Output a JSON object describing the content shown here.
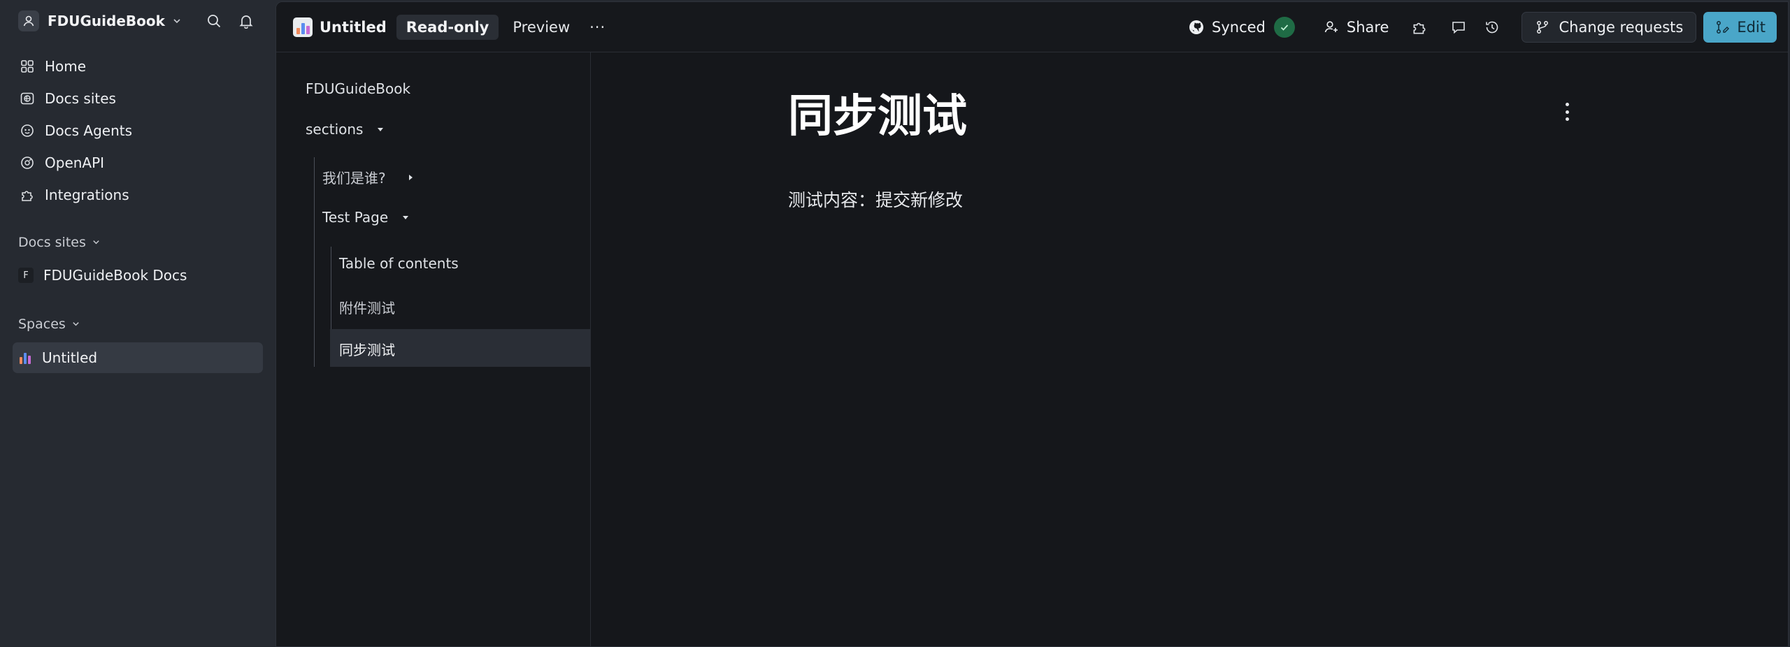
{
  "org": {
    "name": "FDUGuideBook"
  },
  "sidebar": {
    "nav": [
      {
        "label": "Home",
        "icon": "grid-icon"
      },
      {
        "label": "Docs sites",
        "icon": "globe-icon"
      },
      {
        "label": "Docs Agents",
        "icon": "agent-icon"
      },
      {
        "label": "OpenAPI",
        "icon": "api-icon"
      },
      {
        "label": "Integrations",
        "icon": "puzzle-icon"
      }
    ],
    "docs_sites_label": "Docs sites",
    "docs_sites": [
      {
        "badge": "F",
        "label": "FDUGuideBook Docs"
      }
    ],
    "spaces_label": "Spaces",
    "spaces": [
      {
        "label": "Untitled"
      }
    ]
  },
  "topbar": {
    "space_title": "Untitled",
    "mode_label": "Read-only",
    "preview_label": "Preview",
    "more_label": "···",
    "synced_label": "Synced",
    "share_label": "Share",
    "change_requests_label": "Change requests",
    "edit_label": "Edit"
  },
  "tree": {
    "root": "FDUGuideBook",
    "section_label": "sections",
    "items": [
      {
        "label": "我们是谁?"
      },
      {
        "label": "Test Page"
      }
    ],
    "children": [
      {
        "label": "Table of contents"
      },
      {
        "label": "附件测试"
      },
      {
        "label": "同步测试"
      }
    ]
  },
  "content": {
    "title": "同步测试",
    "body": "测试内容：提交新修改"
  },
  "colors": {
    "sidebar_bg": "#262a31",
    "main_bg": "#15171b",
    "accent": "#4aa6c8",
    "synced_green": "#1f6b45"
  }
}
